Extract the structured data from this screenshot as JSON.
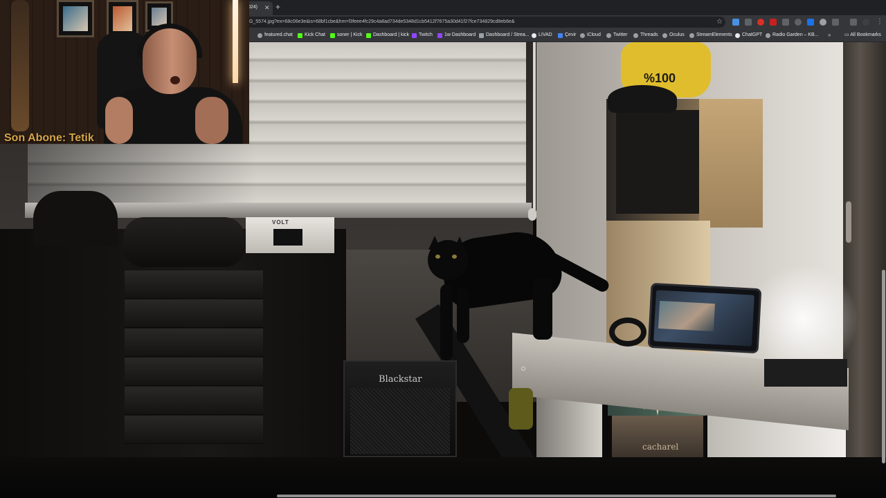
{
  "browser": {
    "tab_title": "024)",
    "url": "IG_5574.jpg?ex=68c06e3e&is=68bf1cbe&hm=f3feee4fc29c4a8ad734de5348d1cb5412f7675a30d41f27fce734829cd8eb6e&",
    "bookmarks": [
      "featured.chat",
      "Kick Chat",
      "soner | Kick",
      "Dashboard | kick",
      "Twitch",
      "1w Dashboard",
      "Dashboard / Strea...",
      "LIVAD",
      "Çevir",
      "iCloud",
      "Twitter",
      "Threads",
      "Oculus",
      "StreamElements",
      "ChatGPT",
      "Radio Garden – KB..."
    ],
    "all_bookmarks": "All Bookmarks",
    "icons": {
      "tab_close": "close-icon",
      "new_tab": "plus-icon",
      "bookmark_star": "star-icon",
      "chrome_menu": "kebab-menu-icon",
      "bookmark_overflow": "chevron-double-right-icon",
      "folder": "folder-icon"
    },
    "symbols": {
      "tab_close": "✕",
      "new_tab": "+",
      "star": "☆",
      "menu": "⋮",
      "overflow": "»",
      "folder": "▭"
    },
    "colors": {
      "tabbar": "#202124",
      "toolbar": "#35363a",
      "text": "#e8eaed"
    }
  },
  "photo": {
    "amp_brand": "Blackstar",
    "device_label": "VOLT",
    "logo_text": "%100",
    "drawer_label": "cacharel"
  },
  "webcam": {
    "caption": "Son Abone: Tetik"
  }
}
